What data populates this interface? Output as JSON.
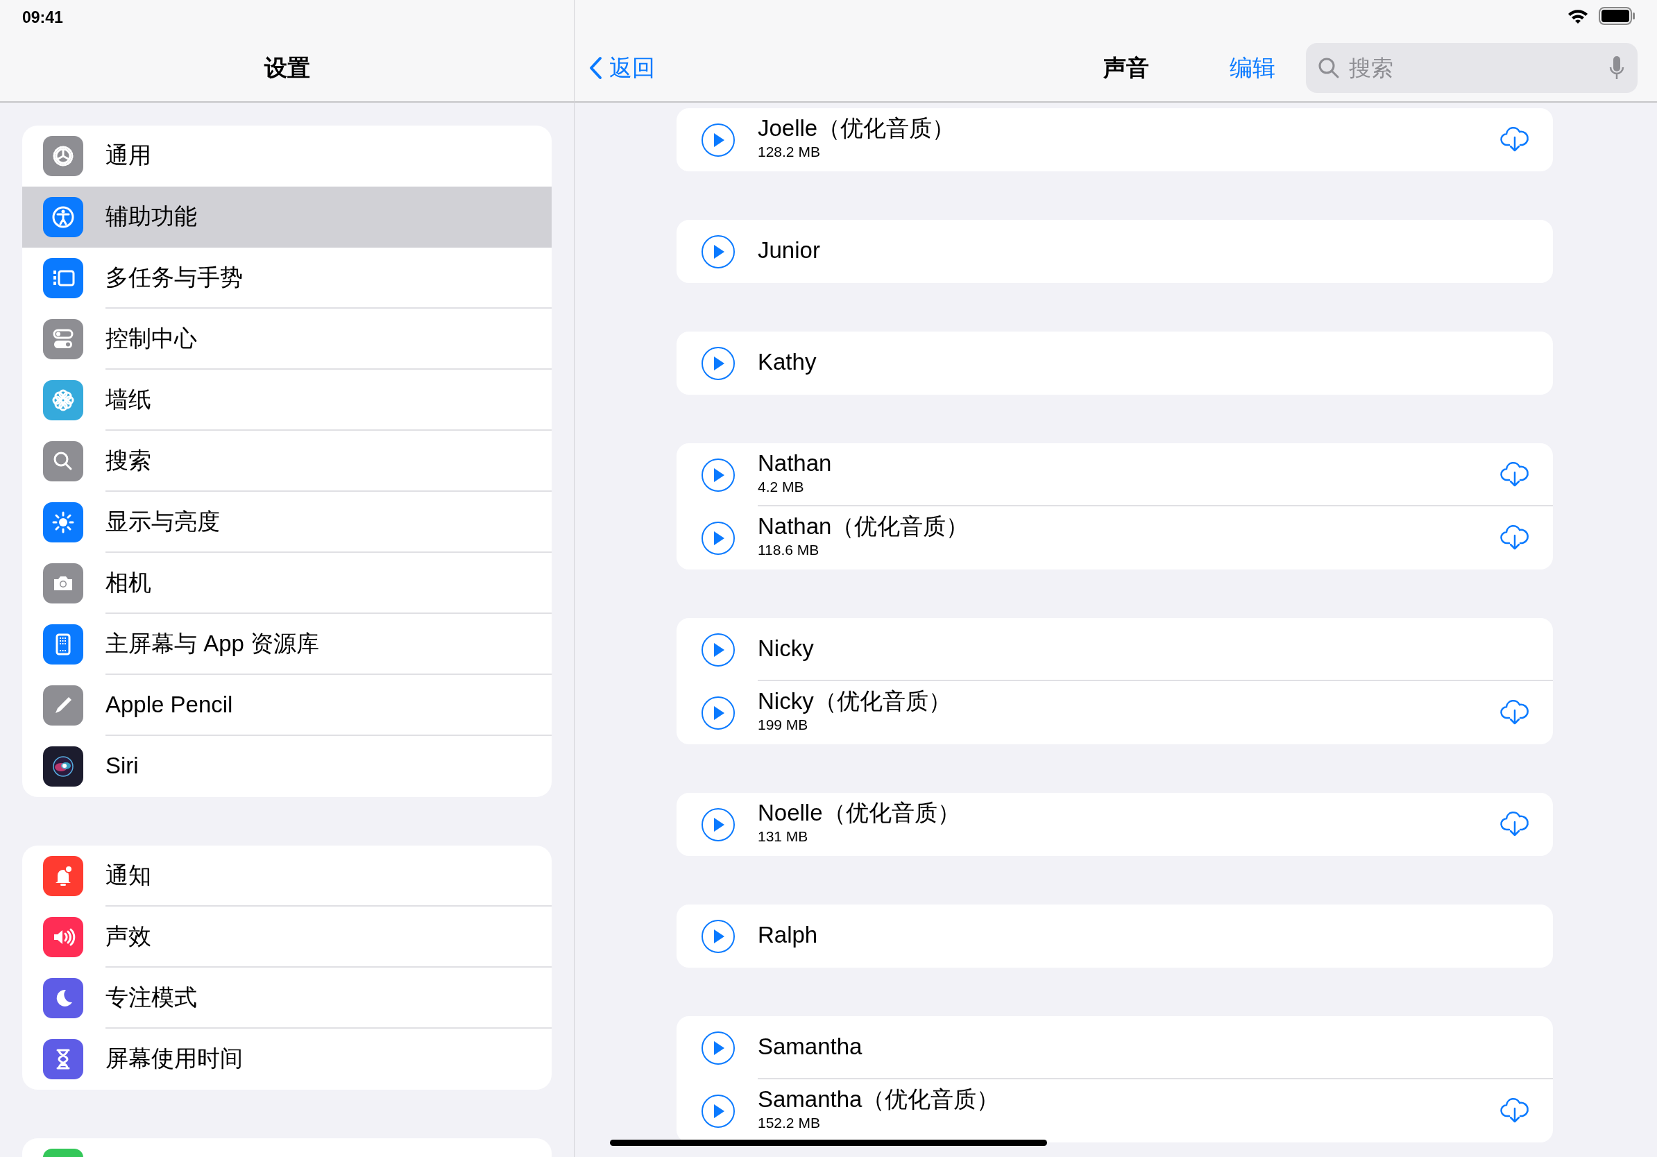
{
  "status_bar": {
    "time": "09:41"
  },
  "sidebar": {
    "title": "设置",
    "groups": [
      [
        {
          "label": "通用",
          "color": "#8e8e93",
          "selected": false
        },
        {
          "label": "辅助功能",
          "color": "#0a7aff",
          "selected": true
        },
        {
          "label": "多任务与手势",
          "color": "#0a7aff",
          "selected": false
        },
        {
          "label": "控制中心",
          "color": "#8e8e93",
          "selected": false
        },
        {
          "label": "墙纸",
          "color": "#35aadc",
          "selected": false
        },
        {
          "label": "搜索",
          "color": "#8e8e93",
          "selected": false
        },
        {
          "label": "显示与亮度",
          "color": "#0a7aff",
          "selected": false
        },
        {
          "label": "相机",
          "color": "#8e8e93",
          "selected": false
        },
        {
          "label": "主屏幕与 App 资源库",
          "color": "#0a7aff",
          "selected": false
        },
        {
          "label": "Apple Pencil",
          "color": "#8e8e93",
          "selected": false
        },
        {
          "label": "Siri",
          "color": "#1c1c2e",
          "selected": false
        }
      ],
      [
        {
          "label": "通知",
          "color": "#ff3b30",
          "selected": false
        },
        {
          "label": "声效",
          "color": "#ff2d55",
          "selected": false
        },
        {
          "label": "专注模式",
          "color": "#5e5ce6",
          "selected": false
        },
        {
          "label": "屏幕使用时间",
          "color": "#5e5ce6",
          "selected": false
        }
      ],
      [
        {
          "color": "#34c759",
          "selected": false
        }
      ]
    ]
  },
  "detail": {
    "back": "返回",
    "title": "声音",
    "edit": "编辑",
    "search": {
      "placeholder": "搜索"
    },
    "voice_groups": [
      [
        {
          "name": "Joelle（优化音质）",
          "size": "128.2 MB",
          "downloadable": true
        }
      ],
      [
        {
          "name": "Junior",
          "downloadable": false
        }
      ],
      [
        {
          "name": "Kathy",
          "downloadable": false
        }
      ],
      [
        {
          "name": "Nathan",
          "size": "4.2 MB",
          "downloadable": true
        },
        {
          "name": "Nathan（优化音质）",
          "size": "118.6 MB",
          "downloadable": true
        }
      ],
      [
        {
          "name": "Nicky",
          "downloadable": false
        },
        {
          "name": "Nicky（优化音质）",
          "size": "199 MB",
          "downloadable": true
        }
      ],
      [
        {
          "name": "Noelle（优化音质）",
          "size": "131 MB",
          "downloadable": true
        }
      ],
      [
        {
          "name": "Ralph",
          "downloadable": false
        }
      ],
      [
        {
          "name": "Samantha",
          "downloadable": false
        },
        {
          "name": "Samantha（优化音质）",
          "size": "152.2 MB",
          "downloadable": true
        }
      ]
    ]
  }
}
